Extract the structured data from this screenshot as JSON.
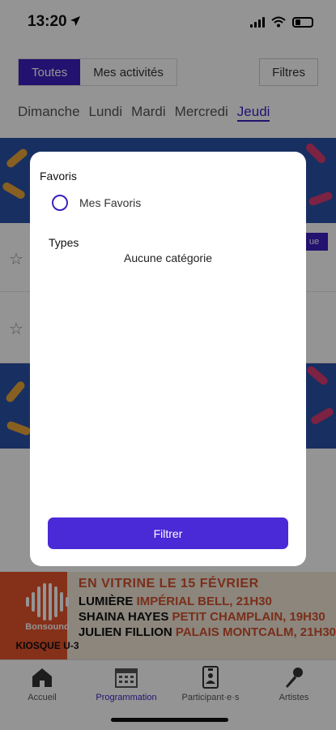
{
  "status_bar": {
    "time": "13:20"
  },
  "header": {
    "segments": [
      {
        "label": "Toutes",
        "active": true
      },
      {
        "label": "Mes activités",
        "active": false
      }
    ],
    "filter_label": "Filtres"
  },
  "days": [
    "Dimanche",
    "Lundi",
    "Mardi",
    "Mercredi",
    "Jeudi"
  ],
  "active_day": "Jeudi",
  "list": {
    "chip_label": "ue"
  },
  "ad": {
    "brand": "Bonsound",
    "kiosk": "KIOSQUE U-3",
    "title": "EN VITRINE LE 15 FÉVRIER",
    "lines": [
      {
        "artist": "LUMIÈRE",
        "venue": "IMPÉRIAL BELL, 21H30"
      },
      {
        "artist": "SHAINA HAYES",
        "venue": "PETIT CHAMPLAIN, 19H30"
      },
      {
        "artist": "JULIEN FILLION",
        "venue": "PALAIS MONTCALM, 21H30"
      }
    ]
  },
  "tabbar": [
    {
      "label": "Accueil",
      "icon": "home-icon",
      "active": false
    },
    {
      "label": "Programmation",
      "icon": "calendar-icon",
      "active": true
    },
    {
      "label": "Participant·e·s",
      "icon": "badge-icon",
      "active": false
    },
    {
      "label": "Artistes",
      "icon": "microphone-icon",
      "active": false
    }
  ],
  "modal": {
    "favoris_title": "Favoris",
    "favoris_option": "Mes Favoris",
    "types_title": "Types",
    "types_empty": "Aucune catégorie",
    "submit_label": "Filtrer"
  },
  "colors": {
    "accent": "#3d1fc0",
    "button": "#4a2ad6",
    "ad_orange": "#e5532c",
    "banner_blue": "#2a52a8"
  }
}
